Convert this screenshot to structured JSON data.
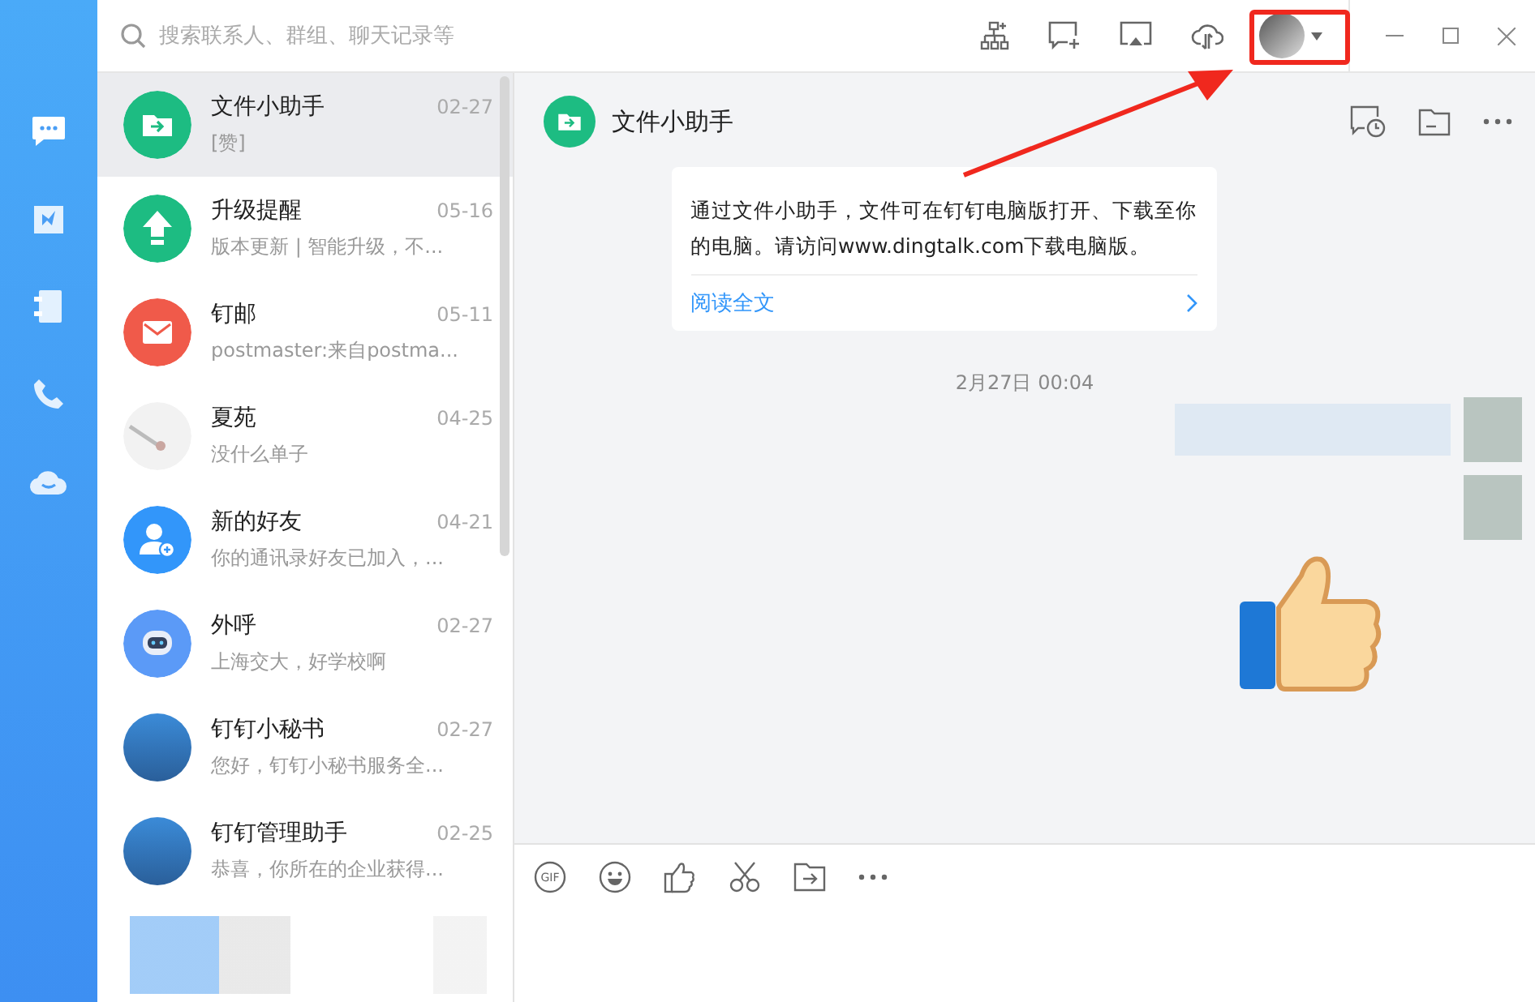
{
  "nav": [
    {
      "kind": "chat"
    },
    {
      "kind": "ding"
    },
    {
      "kind": "contacts"
    },
    {
      "kind": "phone"
    },
    {
      "kind": "cloud"
    }
  ],
  "search": {
    "placeholder": "搜索联系人、群组、聊天记录等"
  },
  "toolbar": [
    {
      "kind": "org"
    },
    {
      "kind": "new-chat"
    },
    {
      "kind": "screen"
    },
    {
      "kind": "cloud-sync"
    }
  ],
  "conversations": [
    {
      "name": "文件小助手",
      "date": "02-27",
      "preview": "[赞]",
      "kind": "file",
      "selected": true
    },
    {
      "name": "升级提醒",
      "date": "05-16",
      "preview": "版本更新 | 智能升级，不...",
      "kind": "upgrade",
      "selected": false
    },
    {
      "name": "钉邮",
      "date": "05-11",
      "preview": "postmaster:来自postma...",
      "kind": "mail",
      "selected": false
    },
    {
      "name": "夏苑",
      "date": "04-25",
      "preview": "没什么单子",
      "kind": "picture",
      "selected": false
    },
    {
      "name": "新的好友",
      "date": "04-21",
      "preview": "你的通讯录好友已加入，...",
      "kind": "add-friend",
      "selected": false
    },
    {
      "name": "外呼",
      "date": "02-27",
      "preview": "上海交大，好学校啊",
      "kind": "robot",
      "selected": false
    },
    {
      "name": "钉钉小秘书",
      "date": "02-27",
      "preview": "您好，钉钉小秘书服务全...",
      "kind": "photo",
      "selected": false
    },
    {
      "name": "钉钉管理助手",
      "date": "02-25",
      "preview": "恭喜，你所在的企业获得...",
      "kind": "photo",
      "selected": false
    }
  ],
  "chat": {
    "title": "文件小助手",
    "card": {
      "text": "通过文件小助手，文件可在钉钉电脑版打开、下载至你的电脑。请访问www.dingtalk.com下载电脑版。",
      "link": "阅读全文"
    },
    "timestamp": "2月27日 00:04"
  },
  "composer": {
    "gif_label": "GIF"
  }
}
